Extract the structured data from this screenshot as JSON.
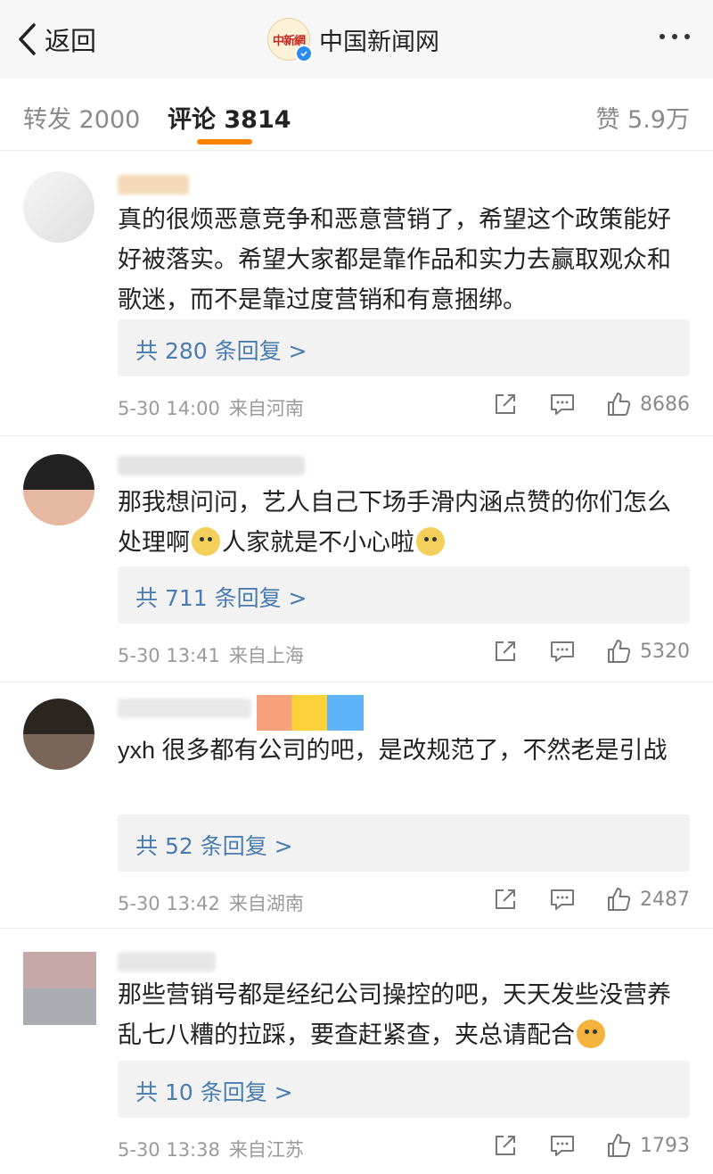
{
  "header": {
    "back_label": "返回",
    "title": "中国新闻网",
    "logo_text": "中新網"
  },
  "tabs": {
    "repost": "转发 2000",
    "comment": "评论 3814",
    "like": "赞 5.9万"
  },
  "comments": [
    {
      "text": "真的很烦恶意竞争和恶意营销了，希望这个政策能好好被落实。希望大家都是靠作品和实力去赢取观众和歌迷，而不是靠过度营销和有意捆绑。",
      "replies": "共 280 条回复 >",
      "time": "5-30 14:00",
      "source": "来自河南",
      "likes": "8686"
    },
    {
      "text_a": "那我想问问，艺人自己下场手滑内涵点赞的你们怎么处理啊",
      "text_b": "人家就是不小心啦",
      "replies": "共 711 条回复 >",
      "time": "5-30 13:41",
      "source": "来自上海",
      "likes": "5320"
    },
    {
      "text": "yxh 很多都有公司的吧，是改规范了，不然老是引战",
      "replies": "共 52 条回复 >",
      "time": "5-30 13:42",
      "source": "来自湖南",
      "likes": "2487"
    },
    {
      "text": "那些营销号都是经纪公司操控的吧，天天发些没营养乱七八糟的拉踩，要查赶紧查，夹总请配合",
      "replies": "共 10 条回复 >",
      "time": "5-30 13:38",
      "source": "来自江苏",
      "likes": "1793"
    }
  ]
}
